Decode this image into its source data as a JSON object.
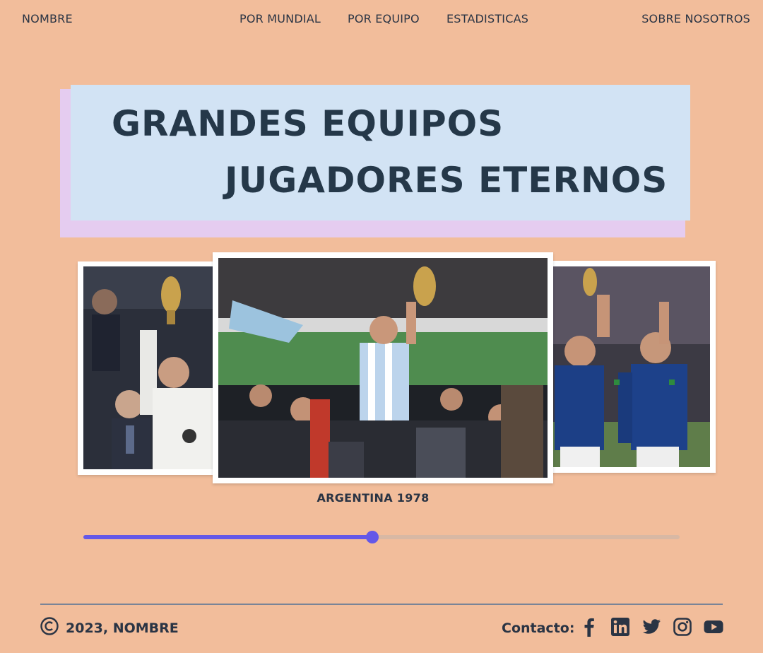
{
  "nav": {
    "brand": "NOMBRE",
    "links": [
      "POR MUNDIAL",
      "POR EQUIPO",
      "ESTADISTICAS"
    ],
    "about": "SOBRE NOSOTROS"
  },
  "hero": {
    "line1": "GRANDES EQUIPOS",
    "line2": "JUGADORES ETERNOS"
  },
  "carousel": {
    "caption": "ARGENTINA 1978",
    "progress": 0.485
  },
  "footer": {
    "copyright": "2023, NOMBRE",
    "contact_label": "Contacto:",
    "social_icons": [
      "facebook-icon",
      "linkedin-icon",
      "twitter-icon",
      "instagram-icon",
      "youtube-icon"
    ]
  },
  "colors": {
    "background": "#f2bd9b",
    "hero_box": "#d2e3f4",
    "hero_shadow": "#e5ccf0",
    "accent": "#6458e8",
    "text": "#253849"
  }
}
